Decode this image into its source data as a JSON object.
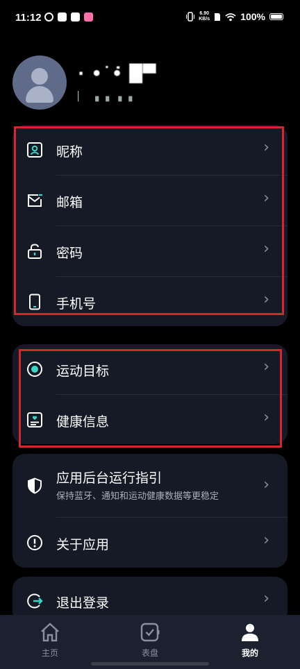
{
  "status_bar": {
    "time": "11:12",
    "net_speed_value": "6.90",
    "net_speed_unit": "KB/s",
    "battery": "100%"
  },
  "profile": {
    "username": "· •˙•̇ █▀",
    "user_id": "▏ ▗ ▖▗ ▖"
  },
  "account_card": {
    "items": [
      {
        "label": "昵称",
        "icon": "profile-card-icon"
      },
      {
        "label": "邮箱",
        "icon": "mail-icon"
      },
      {
        "label": "密码",
        "icon": "lock-icon"
      },
      {
        "label": "手机号",
        "icon": "phone-icon"
      }
    ]
  },
  "health_card": {
    "items": [
      {
        "label": "运动目标",
        "icon": "target-icon"
      },
      {
        "label": "健康信息",
        "icon": "health-info-icon"
      }
    ]
  },
  "app_card": {
    "items": [
      {
        "label": "应用后台运行指引",
        "sublabel": "保持蓝牙、通知和运动健康数据等更稳定",
        "icon": "shield-icon"
      },
      {
        "label": "关于应用",
        "icon": "info-icon"
      }
    ]
  },
  "logout_card": {
    "label": "退出登录",
    "icon": "logout-icon"
  },
  "chevron": "›",
  "tabs": [
    {
      "label": "主页",
      "icon": "home-icon",
      "active": false
    },
    {
      "label": "表盘",
      "icon": "watch-face-icon",
      "active": false
    },
    {
      "label": "我的",
      "icon": "person-icon",
      "active": true
    }
  ],
  "colors": {
    "background": "#000000",
    "card": "#151a26",
    "accent": "#3ad6c6",
    "highlight": "#d8262f",
    "tabbar": "#1c2130"
  }
}
